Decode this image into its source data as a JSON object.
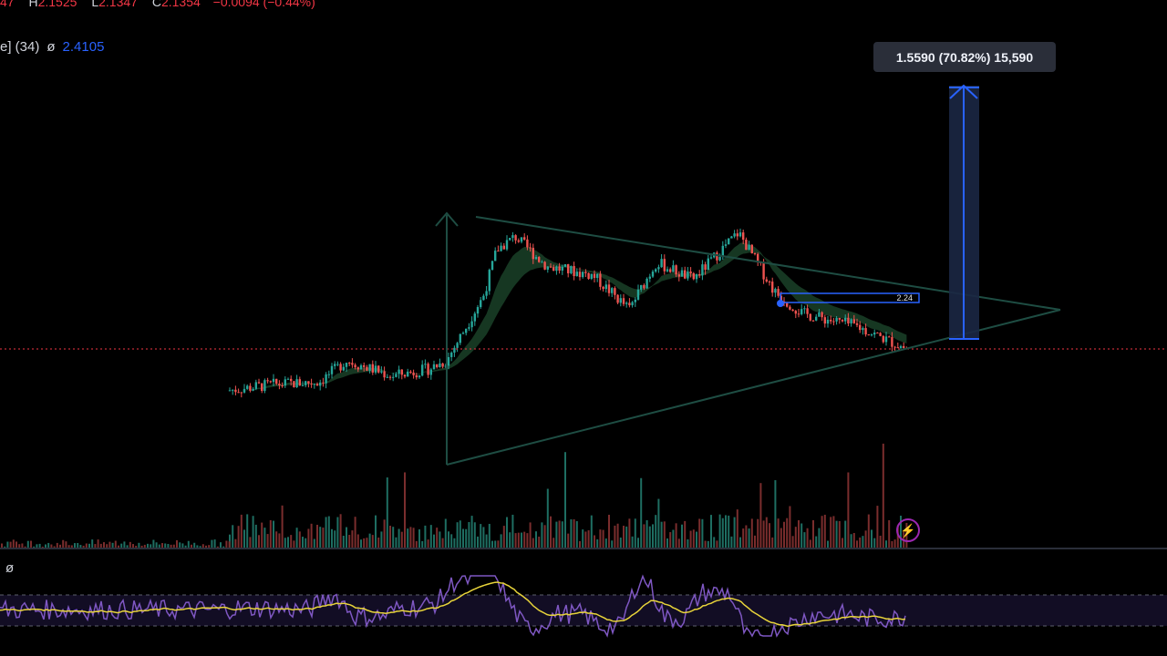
{
  "header": {
    "open_fragment": "47",
    "high_label": "H",
    "high_value": "2.1525",
    "low_label": "L",
    "low_value": "2.1347",
    "close_label": "C",
    "close_value": "2.1354",
    "change": "−0.0094 (−0.44%)"
  },
  "indicator": {
    "label": "e] (34)",
    "symbol": "ø",
    "value": "2.4105"
  },
  "rsi_label": "ø",
  "measure_label": "1.5590 (70.82%) 15,590",
  "level_label": "2.24",
  "alert_icon": "lightning-bolt-icon",
  "colors": {
    "background": "#000000",
    "up_candle": "#26a69a",
    "down_candle": "#ef5350",
    "triangle": "#1e4d43",
    "measure_arrow": "#2962ff",
    "rsi_line": "#7e57c2",
    "rsi_ma": "#e8d43a",
    "price_line": "#f23645"
  },
  "chart_data": {
    "type": "candlestick",
    "pattern": "symmetrical-triangle",
    "ylim": [
      1.5,
      4.4
    ],
    "current_price": 2.1354,
    "level": 2.24,
    "target_move": 1.559,
    "target_move_pct": 70.82,
    "key_prices": [
      1.7,
      2.0,
      2.75,
      3.45,
      3.0,
      2.6,
      3.15,
      2.2,
      3.5,
      2.35,
      2.1354
    ],
    "rsi_bands": [
      70,
      30
    ],
    "volume": true
  }
}
